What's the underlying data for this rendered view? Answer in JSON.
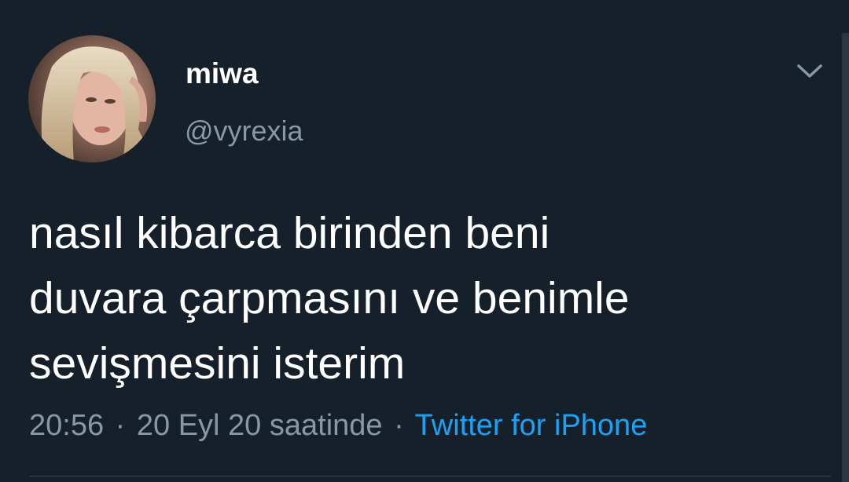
{
  "tweet": {
    "author": {
      "display_name": "miwa",
      "handle": "@vyrexia"
    },
    "text": "nasıl kibarca birinden beni\nduvara çarpmasını ve benimle\nsevişmesini isterim",
    "time": "20:56",
    "date": "20 Eyl 20 saatinde",
    "separator": "·",
    "source": "Twitter for iPhone",
    "menu_icon": "chevron-down-icon"
  },
  "colors": {
    "background": "#15202b",
    "primary_text": "#ffffff",
    "secondary_text": "#8899a6",
    "link": "#1da1f2",
    "divider": "#38444d"
  }
}
